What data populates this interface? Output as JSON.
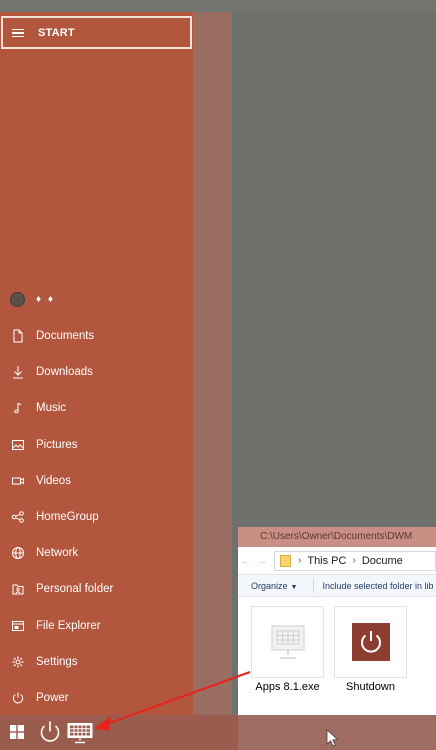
{
  "start_menu": {
    "title": "START",
    "user_name": "♦ ♦",
    "items": [
      {
        "label": "Documents",
        "icon": "document-icon"
      },
      {
        "label": "Downloads",
        "icon": "download-icon"
      },
      {
        "label": "Music",
        "icon": "music-icon"
      },
      {
        "label": "Pictures",
        "icon": "pictures-icon"
      },
      {
        "label": "Videos",
        "icon": "videos-icon"
      },
      {
        "label": "HomeGroup",
        "icon": "homegroup-icon"
      },
      {
        "label": "Network",
        "icon": "network-icon"
      },
      {
        "label": "Personal folder",
        "icon": "personal-folder-icon"
      },
      {
        "label": "File Explorer",
        "icon": "file-explorer-icon"
      },
      {
        "label": "Settings",
        "icon": "settings-icon"
      },
      {
        "label": "Power",
        "icon": "power-icon"
      }
    ]
  },
  "explorer": {
    "title_path": "C:\\Users\\Owner\\Documents\\DWM",
    "address_this_pc": "This PC",
    "address_next": "Docume",
    "toolbar_organize": "Organize",
    "toolbar_include": "Include selected folder in lib",
    "files": [
      {
        "name": "Apps 8.1.exe",
        "icon": "keyboard-monitor-icon"
      },
      {
        "name": "Shutdown",
        "icon": "shutdown-icon"
      }
    ]
  },
  "colors": {
    "start_bg": "#b3563e",
    "taskbar_bg": "#9a5c4d",
    "annotation_arrow": "#e8231c"
  }
}
